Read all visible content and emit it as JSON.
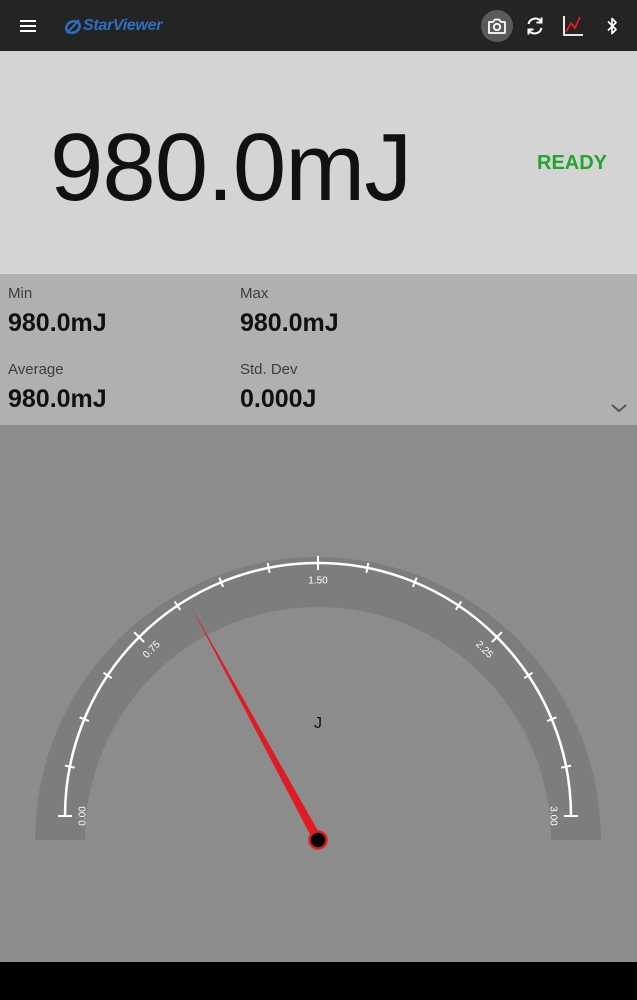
{
  "app": {
    "brand": "StarViewer"
  },
  "toolbar": {
    "menu_icon": "hamburger-menu-icon",
    "camera_icon": "camera-icon",
    "refresh_icon": "refresh-icon",
    "chart_icon": "chart-icon",
    "bluetooth_icon": "bluetooth-icon"
  },
  "reading": {
    "value": "980.0mJ",
    "status": "READY",
    "status_color": "#22a52e"
  },
  "stats": {
    "min_label": "Min",
    "min_value": "980.0mJ",
    "max_label": "Max",
    "max_value": "980.0mJ",
    "avg_label": "Average",
    "avg_value": "980.0mJ",
    "std_label": "Std. Dev",
    "std_value": "0.000J",
    "expand_icon": "chevron-down-icon"
  },
  "gauge": {
    "unit": "J",
    "min": 0,
    "max": 3,
    "value": 0.98,
    "labels": [
      "0.00",
      "0.75",
      "1.50",
      "2.25",
      "3.00"
    ],
    "needle_color": "#e01b24"
  }
}
